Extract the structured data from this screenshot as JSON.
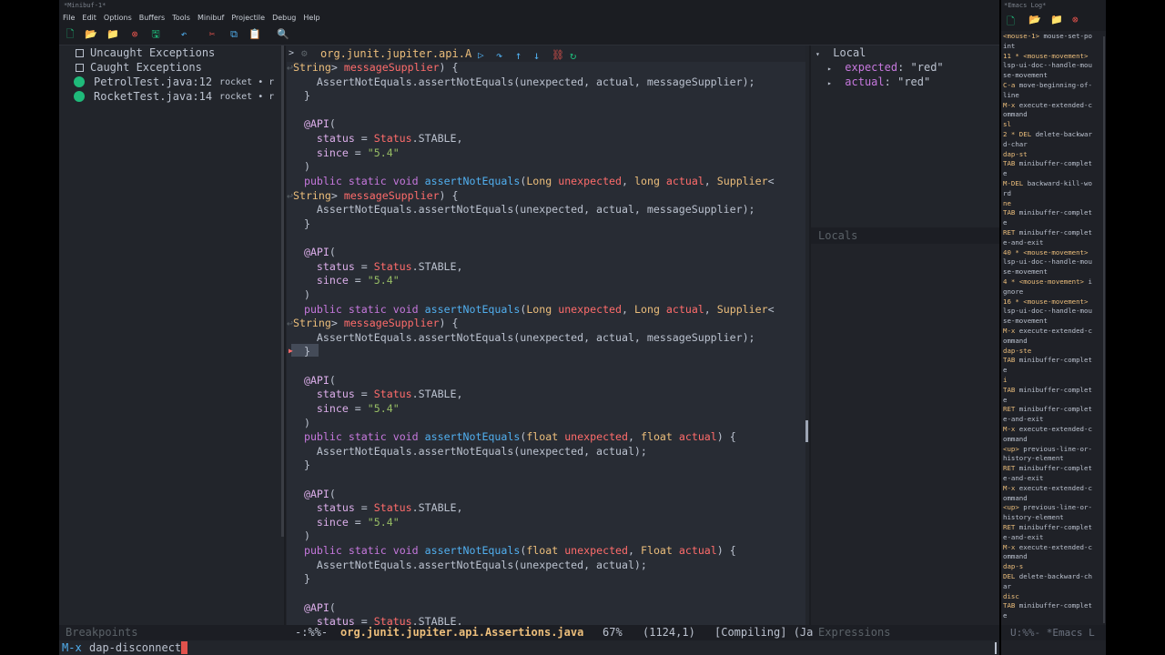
{
  "window": {
    "title": "*Minibuf-1*"
  },
  "menu": [
    "File",
    "Edit",
    "Options",
    "Buffers",
    "Tools",
    "Minibuf",
    "Projectile",
    "Debug",
    "Help"
  ],
  "toolbar_icons": [
    "new-file-icon",
    "open-folder-icon",
    "open-dir-icon",
    "close-icon",
    "save-icon",
    "undo-icon",
    "cut-icon",
    "copy-icon",
    "paste-icon",
    "search-icon"
  ],
  "breakpoints": {
    "options": [
      {
        "label": "Uncaught Exceptions"
      },
      {
        "label": "Caught Exceptions"
      }
    ],
    "items": [
      {
        "file": "PetrolTest.java:12",
        "project": "rocket • r"
      },
      {
        "file": "RocketTest.java:14",
        "project": "rocket • r"
      }
    ],
    "modeline": "Breakpoints"
  },
  "editor": {
    "header": "org.junit.jupiter.api.A",
    "header_prompt": ">",
    "colors": {
      "keyword": "#c678dd",
      "type": "#ecbe7b",
      "string": "#98be65",
      "function": "#51afef",
      "variable": "#dcaeea"
    },
    "lines": [
      "<String> messageSupplier) {",
      "    AssertNotEquals.assertNotEquals(unexpected, actual, messageSupplier);",
      "  }",
      "",
      "  @API(",
      "    status = Status.STABLE,",
      "    since = \"5.4\"",
      "  )",
      "  public static void assertNotEquals(Long unexpected, long actual, Supplier<",
      "<String> messageSupplier) {",
      "    AssertNotEquals.assertNotEquals(unexpected, actual, messageSupplier);",
      "  }",
      "",
      "  @API(",
      "    status = Status.STABLE,",
      "    since = \"5.4\"",
      "  )",
      "  public static void assertNotEquals(Long unexpected, Long actual, Supplier<",
      "<String> messageSupplier) {",
      "    AssertNotEquals.assertNotEquals(unexpected, actual, messageSupplier);",
      "  }",
      "",
      "  @API(",
      "    status = Status.STABLE,",
      "    since = \"5.4\"",
      "  )",
      "  public static void assertNotEquals(float unexpected, float actual) {",
      "    AssertNotEquals.assertNotEquals(unexpected, actual);",
      "  }",
      "",
      "  @API(",
      "    status = Status.STABLE,",
      "    since = \"5.4\"",
      "  )",
      "  public static void assertNotEquals(float unexpected, Float actual) {",
      "    AssertNotEquals.assertNotEquals(unexpected, actual);",
      "  }",
      "",
      "  @API(",
      "    status = Status.STABLE,"
    ]
  },
  "locals": {
    "scope": "Local",
    "vars": [
      {
        "name": "expected",
        "value": "\"red\""
      },
      {
        "name": "actual",
        "value": "\"red\""
      }
    ],
    "lower_title": "Locals",
    "expressions_title": "Expressions"
  },
  "modeline": {
    "state": "-:%%-",
    "buffer": "org.junit.jupiter.api.Assertions.java",
    "percent": "67%",
    "position": "(1124,1)",
    "mode": "[Compiling] (Ja"
  },
  "minibuffer": {
    "prompt": "M-x",
    "input": "dap-disconnect"
  },
  "log": {
    "title": "*Emacs Log*",
    "lines": [
      {
        "k": "<mouse-1>",
        "c": " mouse-set-po"
      },
      {
        "k": "",
        "c": "int"
      },
      {
        "k": "11 * <mouse-movement>",
        "c": ""
      },
      {
        "k": "",
        "c": "lsp-ui-doc--handle-mou"
      },
      {
        "k": "",
        "c": "se-movement"
      },
      {
        "k": "C-a",
        "c": " move-beginning-of-"
      },
      {
        "k": "",
        "c": "line"
      },
      {
        "k": "M-x",
        "c": " execute-extended-c"
      },
      {
        "k": "",
        "c": "ommand"
      },
      {
        "k": "sl",
        "c": ""
      },
      {
        "k": "2 * DEL",
        "c": " delete-backwar"
      },
      {
        "k": "",
        "c": "d-char"
      },
      {
        "k": "dap-st",
        "c": ""
      },
      {
        "k": "TAB",
        "c": " minibuffer-complet"
      },
      {
        "k": "",
        "c": "e"
      },
      {
        "k": "M-DEL",
        "c": " backward-kill-wo"
      },
      {
        "k": "",
        "c": "rd"
      },
      {
        "k": "ne",
        "c": ""
      },
      {
        "k": "TAB",
        "c": " minibuffer-complet"
      },
      {
        "k": "",
        "c": "e"
      },
      {
        "k": "RET",
        "c": " minibuffer-complet"
      },
      {
        "k": "",
        "c": "e-and-exit"
      },
      {
        "k": "40 * <mouse-movement>",
        "c": ""
      },
      {
        "k": "",
        "c": "lsp-ui-doc--handle-mou"
      },
      {
        "k": "",
        "c": "se-movement"
      },
      {
        "k": "4 * <mouse-movement>",
        "c": " i"
      },
      {
        "k": "",
        "c": "gnore"
      },
      {
        "k": "16 * <mouse-movement>",
        "c": ""
      },
      {
        "k": "",
        "c": "lsp-ui-doc--handle-mou"
      },
      {
        "k": "",
        "c": "se-movement"
      },
      {
        "k": "M-x",
        "c": " execute-extended-c"
      },
      {
        "k": "",
        "c": "ommand"
      },
      {
        "k": "dap-ste",
        "c": ""
      },
      {
        "k": "TAB",
        "c": " minibuffer-complet"
      },
      {
        "k": "",
        "c": "e"
      },
      {
        "k": "i",
        "c": ""
      },
      {
        "k": "TAB",
        "c": " minibuffer-complet"
      },
      {
        "k": "",
        "c": "e"
      },
      {
        "k": "RET",
        "c": " minibuffer-complet"
      },
      {
        "k": "",
        "c": "e-and-exit"
      },
      {
        "k": "M-x",
        "c": " execute-extended-c"
      },
      {
        "k": "",
        "c": "ommand"
      },
      {
        "k": "<up>",
        "c": " previous-line-or-"
      },
      {
        "k": "",
        "c": "history-element"
      },
      {
        "k": "RET",
        "c": " minibuffer-complet"
      },
      {
        "k": "",
        "c": "e-and-exit"
      },
      {
        "k": "M-x",
        "c": " execute-extended-c"
      },
      {
        "k": "",
        "c": "ommand"
      },
      {
        "k": "<up>",
        "c": " previous-line-or-"
      },
      {
        "k": "",
        "c": "history-element"
      },
      {
        "k": "RET",
        "c": " minibuffer-complet"
      },
      {
        "k": "",
        "c": "e-and-exit"
      },
      {
        "k": "M-x",
        "c": " execute-extended-c"
      },
      {
        "k": "",
        "c": "ommand"
      },
      {
        "k": "dap-s",
        "c": ""
      },
      {
        "k": "DEL",
        "c": " delete-backward-ch"
      },
      {
        "k": "",
        "c": "ar"
      },
      {
        "k": "disc",
        "c": ""
      },
      {
        "k": "TAB",
        "c": " minibuffer-complet"
      },
      {
        "k": "",
        "c": "e"
      }
    ],
    "modeline": "U:%%-  *Emacs L"
  }
}
